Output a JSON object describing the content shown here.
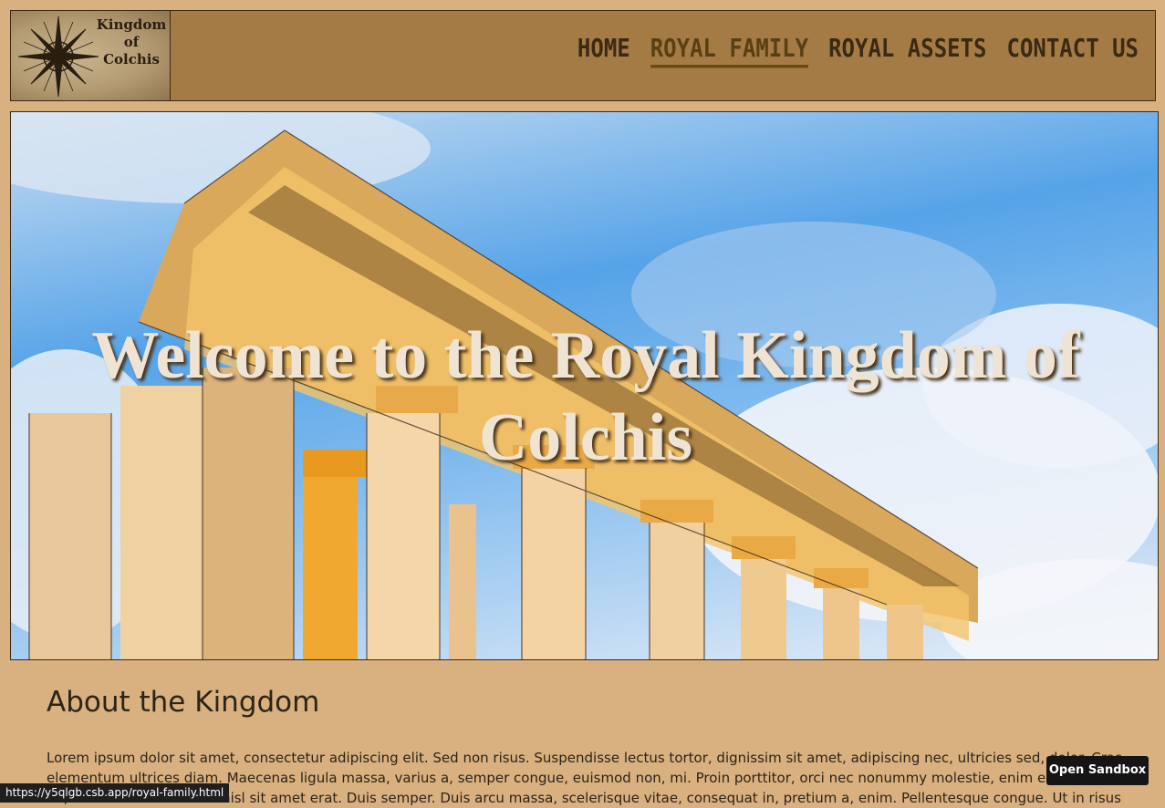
{
  "header": {
    "logo_text": "Kingdom\nof\nColchis",
    "nav": [
      {
        "label": "Home",
        "active": false
      },
      {
        "label": "Royal Family",
        "active": true
      },
      {
        "label": "Royal Assets",
        "active": false
      },
      {
        "label": "Contact Us",
        "active": false
      }
    ]
  },
  "hero": {
    "title": "Welcome to the Royal Kingdom of Colchis"
  },
  "about": {
    "title": "About the Kingdom",
    "text": "Lorem ipsum dolor sit amet, consectetur adipiscing elit. Sed non risus. Suspendisse lectus tortor, dignissim sit amet, adipiscing nec, ultricies sed, dolor. Cras elementum ultrices diam. Maecenas ligula massa, varius a, semper congue, euismod non, mi. Proin porttitor, orci nec nonummy molestie, enim est eleifend mi, non fermentum diam nisl sit amet erat. Duis semper. Duis arcu massa, scelerisque vitae, consequat in, pretium a, enim. Pellentesque congue. Ut in risus"
  },
  "status_bar": {
    "url": "https://y5qlgb.csb.app/royal-family.html"
  },
  "sandbox": {
    "button_label": "Open Sandbox"
  },
  "colors": {
    "page_bg": "#d9b07f",
    "header_bg": "#a57b45",
    "nav_text": "#3a2a14",
    "hero_title": "#efe4d4"
  }
}
